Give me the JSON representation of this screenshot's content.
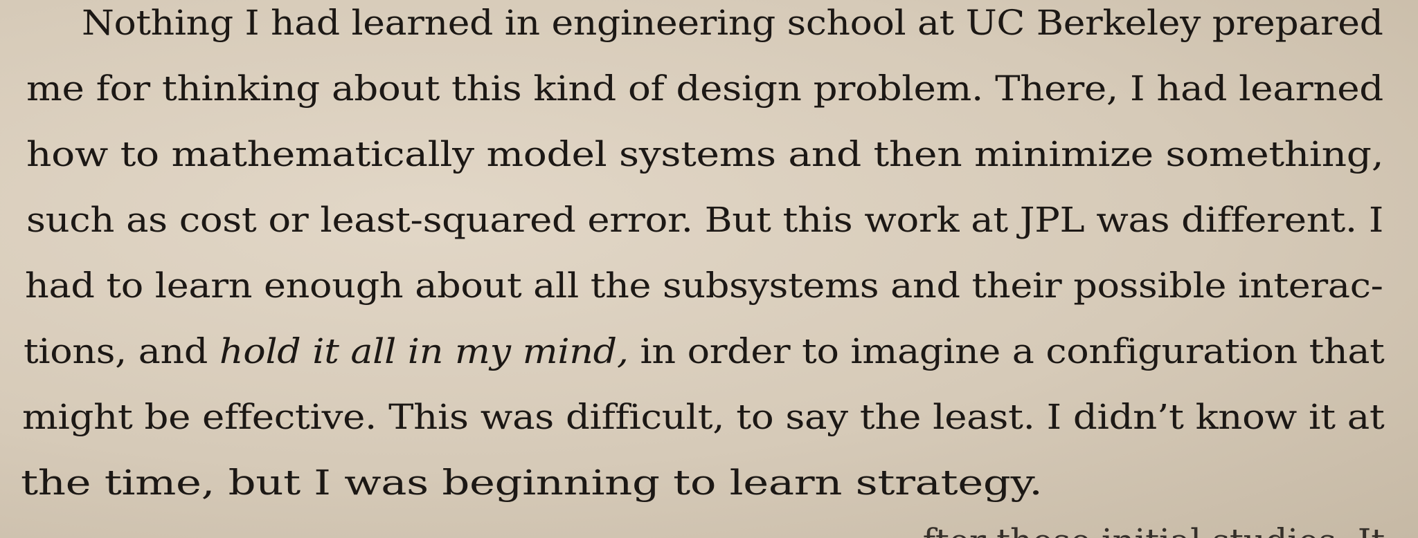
{
  "document": {
    "lines": [
      "Nothing I had learned in engineering school at UC Berkeley prepared",
      "me for thinking about this kind of design problem. There, I had learned",
      "how to mathematically model systems and then minimize something,",
      "such as cost or least-squared error. But this work at JPL was different. I",
      "had to learn enough about all the subsystems and their possible interac-",
      {
        "before": "tions, and ",
        "italic": "hold it all in my mind,",
        "after": " in order to imagine a configuration that"
      },
      "might be effective. This was difficult, to say the least. I didn’t know it at",
      "the time, but I was beginning to learn strategy.",
      "fter those initial studies. It"
    ]
  }
}
